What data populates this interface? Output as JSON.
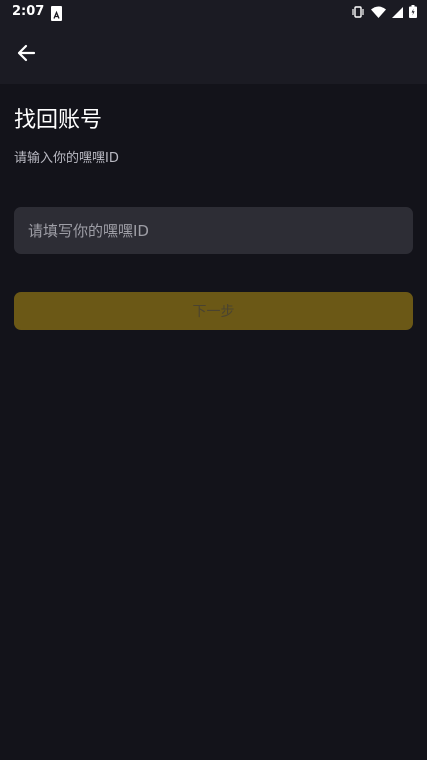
{
  "status_bar": {
    "time": "2:07",
    "notification_icon": "a-letter-icon",
    "icons": [
      "vibrate-icon",
      "wifi-icon",
      "signal-icon",
      "battery-icon"
    ]
  },
  "app_bar": {
    "back_icon": "arrow-left-icon"
  },
  "page": {
    "title": "找回账号",
    "subtitle": "请输入你的嘿嘿ID"
  },
  "form": {
    "id_input": {
      "value": "",
      "placeholder": "请填写你的嘿嘿ID"
    },
    "next_button_label": "下一步"
  },
  "colors": {
    "background": "#13131a",
    "app_bar": "#1b1b23",
    "input_background": "#2d2d35",
    "button_disabled": "#6b5816",
    "button_text_disabled": "#4a4330"
  }
}
